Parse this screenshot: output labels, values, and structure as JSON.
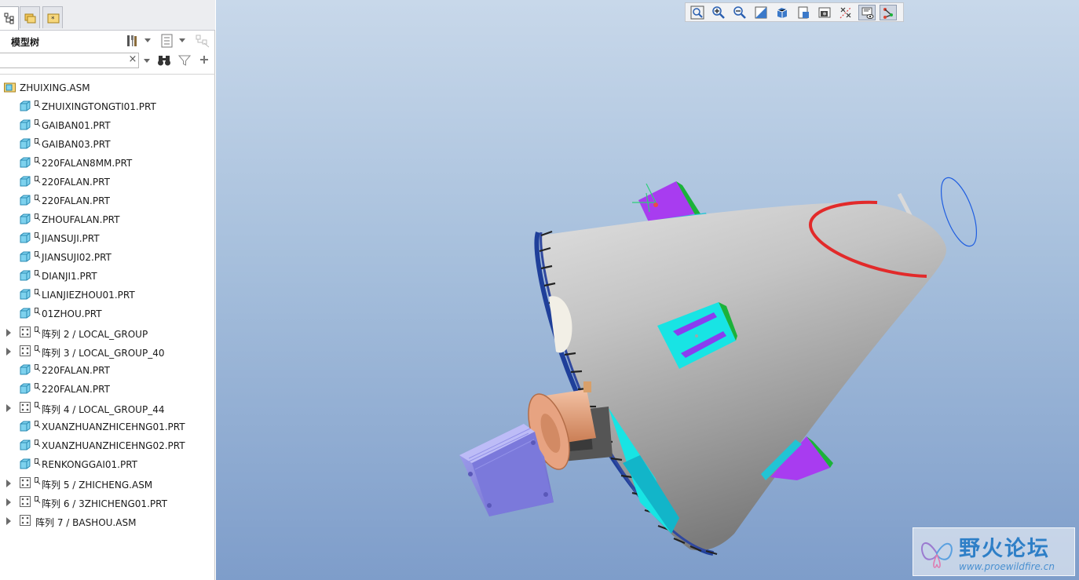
{
  "panel": {
    "tree_title": "模型树",
    "search": {
      "value": "",
      "clear_glyph": "×"
    },
    "tabs": [
      "model-tree-tab",
      "folder-browser-tab",
      "favorites-tab"
    ]
  },
  "tree": {
    "root": "ZHUIXING.ASM",
    "items": [
      {
        "label": "ZHUIXINGTONGTI01.PRT",
        "kind": "part",
        "expandable": false
      },
      {
        "label": "GAIBAN01.PRT",
        "kind": "part",
        "expandable": false
      },
      {
        "label": "GAIBAN03.PRT",
        "kind": "part",
        "expandable": false
      },
      {
        "label": "220FALAN8MM.PRT",
        "kind": "part",
        "expandable": false
      },
      {
        "label": "220FALAN.PRT",
        "kind": "part",
        "expandable": false
      },
      {
        "label": "220FALAN.PRT",
        "kind": "part",
        "expandable": false
      },
      {
        "label": "ZHOUFALAN.PRT",
        "kind": "part",
        "expandable": false
      },
      {
        "label": "JIANSUJI.PRT",
        "kind": "part",
        "expandable": false
      },
      {
        "label": "JIANSUJI02.PRT",
        "kind": "part",
        "expandable": false
      },
      {
        "label": "DIANJI1.PRT",
        "kind": "part",
        "expandable": false
      },
      {
        "label": "LIANJIEZHOU01.PRT",
        "kind": "part",
        "expandable": false
      },
      {
        "label": "01ZHOU.PRT",
        "kind": "part",
        "expandable": false
      },
      {
        "label": "阵列 2 / LOCAL_GROUP",
        "kind": "pattern",
        "expandable": true
      },
      {
        "label": "阵列 3 / LOCAL_GROUP_40",
        "kind": "pattern",
        "expandable": true
      },
      {
        "label": "220FALAN.PRT",
        "kind": "part",
        "expandable": false
      },
      {
        "label": "220FALAN.PRT",
        "kind": "part",
        "expandable": false
      },
      {
        "label": "阵列 4 / LOCAL_GROUP_44",
        "kind": "pattern",
        "expandable": true
      },
      {
        "label": "XUANZHUANZHICEHNG01.PRT",
        "kind": "part",
        "expandable": false
      },
      {
        "label": "XUANZHUANZHICEHNG02.PRT",
        "kind": "part",
        "expandable": false
      },
      {
        "label": "RENKONGGAI01.PRT",
        "kind": "part",
        "expandable": false
      },
      {
        "label": "阵列 5 / ZHICHENG.ASM",
        "kind": "pattern",
        "expandable": true
      },
      {
        "label": "阵列 6 / 3ZHICHENG01.PRT",
        "kind": "pattern",
        "expandable": true
      },
      {
        "label": "阵列 7 / BASHOU.ASM",
        "kind": "pattern",
        "expandable": true
      }
    ]
  },
  "toolbar": {
    "buttons": [
      "refit-icon",
      "zoom-in-icon",
      "zoom-out-icon",
      "repaint-icon",
      "display-style-icon",
      "saved-views-icon",
      "view-manager-icon",
      "datum-display-icon",
      "spin-center-icon",
      "annotation-display-icon"
    ]
  },
  "watermark": {
    "title": "野火论坛",
    "url": "www.proewildfire.cn"
  },
  "colors": {
    "accent": "#2e7fc7",
    "cone": "#b5b5b5",
    "bracket": "#00e5e5",
    "fin": "#a83cf0"
  }
}
